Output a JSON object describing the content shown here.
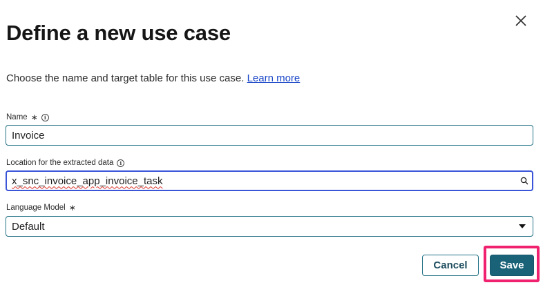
{
  "dialog": {
    "title": "Define a new use case",
    "description": "Choose the name and target table for this use case.",
    "learn_more": "Learn more"
  },
  "fields": {
    "name": {
      "label": "Name",
      "required_mark": "∗",
      "value": "Invoice"
    },
    "location": {
      "label": "Location for the extracted data",
      "value": "x_snc_invoice_app_invoice_task"
    },
    "language_model": {
      "label": "Language Model",
      "required_mark": "∗",
      "value": "Default"
    }
  },
  "buttons": {
    "cancel": "Cancel",
    "save": "Save"
  },
  "icons": {
    "close": "close-icon",
    "info": "info-icon",
    "search": "search-icon",
    "dropdown": "chevron-down-icon"
  },
  "colors": {
    "primary": "#1a6278",
    "field_border": "#1f6f83",
    "focus_border": "#3b55d9",
    "highlight": "#f0216f",
    "link": "#1a47c8"
  }
}
